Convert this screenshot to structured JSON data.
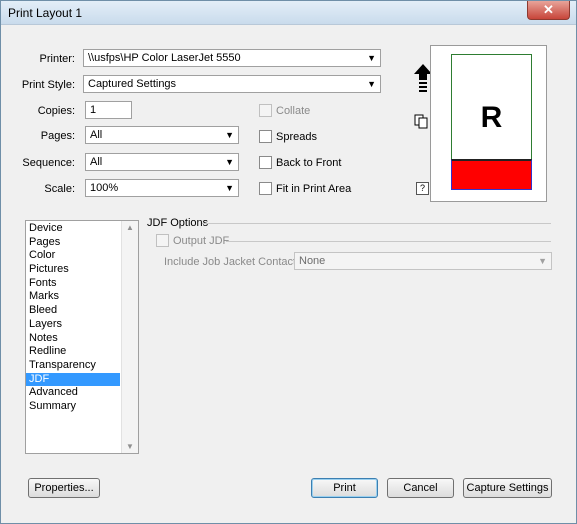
{
  "window": {
    "title": "Print Layout 1",
    "close_glyph": "✕"
  },
  "form": {
    "printer": {
      "label": "Printer:",
      "value": "\\\\usfps\\HP Color LaserJet 5550"
    },
    "print_style": {
      "label": "Print Style:",
      "value": "Captured Settings"
    },
    "copies": {
      "label": "Copies:",
      "value": "1"
    },
    "pages": {
      "label": "Pages:",
      "value": "All"
    },
    "sequence": {
      "label": "Sequence:",
      "value": "All"
    },
    "scale": {
      "label": "Scale:",
      "value": "100%"
    },
    "collate": {
      "label": "Collate",
      "checked": false,
      "enabled": false
    },
    "spreads": {
      "label": "Spreads",
      "checked": false
    },
    "back_to_front": {
      "label": "Back to Front",
      "checked": false
    },
    "fit_in_print_area": {
      "label": "Fit in Print Area",
      "checked": false
    }
  },
  "preview": {
    "letter": "R",
    "help_glyph": "?",
    "colors": {
      "border_top": "#2e7d32",
      "bottom_band": "#ff0000",
      "bottom_border": "#3333cc"
    }
  },
  "sidebar": {
    "items": [
      "Device",
      "Pages",
      "Color",
      "Pictures",
      "Fonts",
      "Marks",
      "Bleed",
      "Layers",
      "Notes",
      "Redline",
      "Transparency",
      "JDF",
      "Advanced",
      "Summary"
    ],
    "selected": "JDF"
  },
  "jdf": {
    "group_title": "JDF Options",
    "output_jdf": {
      "label": "Output JDF",
      "checked": false
    },
    "job_jacket_contact": {
      "label": "Include Job Jacket Contact:",
      "value": "None"
    }
  },
  "buttons": {
    "properties": "Properties...",
    "print": "Print",
    "cancel": "Cancel",
    "capture_settings": "Capture Settings"
  }
}
